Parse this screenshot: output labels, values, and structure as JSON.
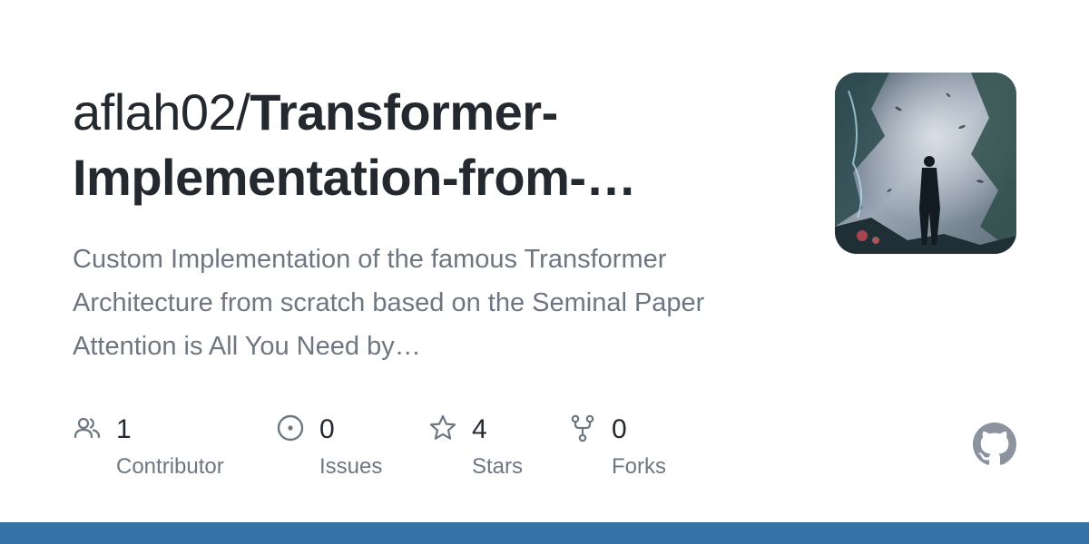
{
  "repo": {
    "owner": "aflah02/",
    "name_line1": "Transformer-",
    "name_line2": "Implementation-from-…",
    "description": "Custom Implementation of the famous Transformer Architecture from scratch based on the Seminal Paper Attention is All You Need by…"
  },
  "stats": {
    "contributors": {
      "value": "1",
      "label": "Contributor",
      "icon": "people-icon"
    },
    "issues": {
      "value": "0",
      "label": "Issues",
      "icon": "issue-opened-icon"
    },
    "stars": {
      "value": "4",
      "label": "Stars",
      "icon": "star-icon"
    },
    "forks": {
      "value": "0",
      "label": "Forks",
      "icon": "repo-forked-icon"
    }
  },
  "colors": {
    "title": "#24292f",
    "muted": "#6e7781",
    "bottom_bar": "#3572a5",
    "github_logo": "#8b949e"
  }
}
